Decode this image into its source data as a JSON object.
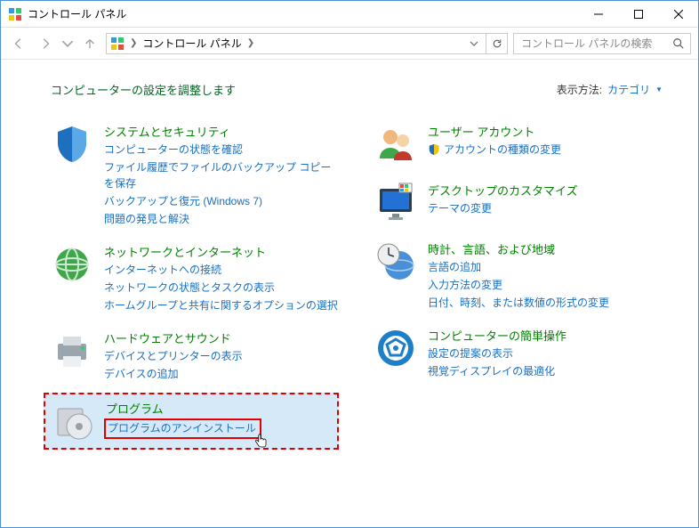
{
  "window": {
    "title": "コントロール パネル"
  },
  "breadcrumb": {
    "root": "コントロール パネル"
  },
  "search": {
    "placeholder": "コントロール パネルの検索"
  },
  "header": {
    "title": "コンピューターの設定を調整します",
    "view_by_label": "表示方法:",
    "view_by_value": "カテゴリ"
  },
  "categories": {
    "left": [
      {
        "title": "システムとセキュリティ",
        "links": [
          "コンピューターの状態を確認",
          "ファイル履歴でファイルのバックアップ コピーを保存",
          "バックアップと復元 (Windows 7)",
          "問題の発見と解決"
        ]
      },
      {
        "title": "ネットワークとインターネット",
        "links": [
          "インターネットへの接続",
          "ネットワークの状態とタスクの表示",
          "ホームグループと共有に関するオプションの選択"
        ]
      },
      {
        "title": "ハードウェアとサウンド",
        "links": [
          "デバイスとプリンターの表示",
          "デバイスの追加"
        ]
      },
      {
        "title": "プログラム",
        "links": [
          "プログラムのアンインストール"
        ]
      }
    ],
    "right": [
      {
        "title": "ユーザー アカウント",
        "links": [
          "アカウントの種類の変更"
        ]
      },
      {
        "title": "デスクトップのカスタマイズ",
        "links": [
          "テーマの変更"
        ]
      },
      {
        "title": "時計、言語、および地域",
        "links": [
          "言語の追加",
          "入力方法の変更",
          "日付、時刻、または数値の形式の変更"
        ]
      },
      {
        "title": "コンピューターの簡単操作",
        "links": [
          "設定の提案の表示",
          "視覚ディスプレイの最適化"
        ]
      }
    ]
  }
}
